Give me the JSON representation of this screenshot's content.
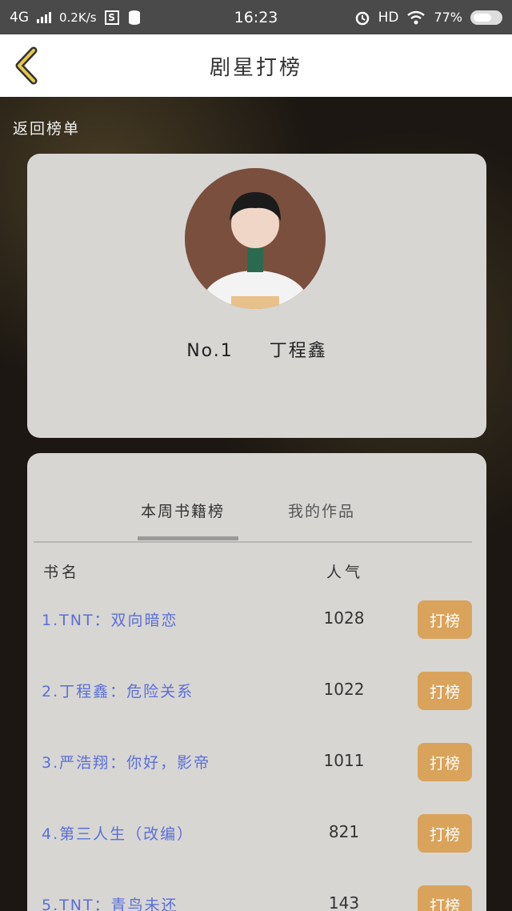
{
  "status_bar": {
    "network": "4G",
    "speed": "0.2K/s",
    "s_badge": "S",
    "time": "16:23",
    "hd": "HD",
    "battery": "77%",
    "icons": [
      "signal-icon",
      "s-box-icon",
      "database-icon",
      "alarm-icon",
      "wifi-icon",
      "battery-icon"
    ]
  },
  "header": {
    "title": "剧星打榜",
    "back_icon": "chevron-left-icon"
  },
  "return_link": "返回榜单",
  "profile": {
    "rank": "No.1",
    "name": "丁程鑫"
  },
  "tabs": {
    "active": "本周书籍榜",
    "inactive": "我的作品"
  },
  "columns": {
    "name": "书名",
    "popularity": "人气"
  },
  "books": [
    {
      "title": "1.TNT：双向暗恋",
      "count": "1028",
      "button": "打榜"
    },
    {
      "title": "2.丁程鑫：危险关系",
      "count": "1022",
      "button": "打榜"
    },
    {
      "title": "3.严浩翔：你好，影帝",
      "count": "1011",
      "button": "打榜"
    },
    {
      "title": "4.第三人生（改编）",
      "count": "821",
      "button": "打榜"
    },
    {
      "title": "5.TNT：青鸟未还",
      "count": "143",
      "button": "打榜"
    }
  ],
  "colors": {
    "accent_button": "#d9a35b",
    "book_link": "#5b6ed8",
    "card": "#d7d6d3"
  }
}
